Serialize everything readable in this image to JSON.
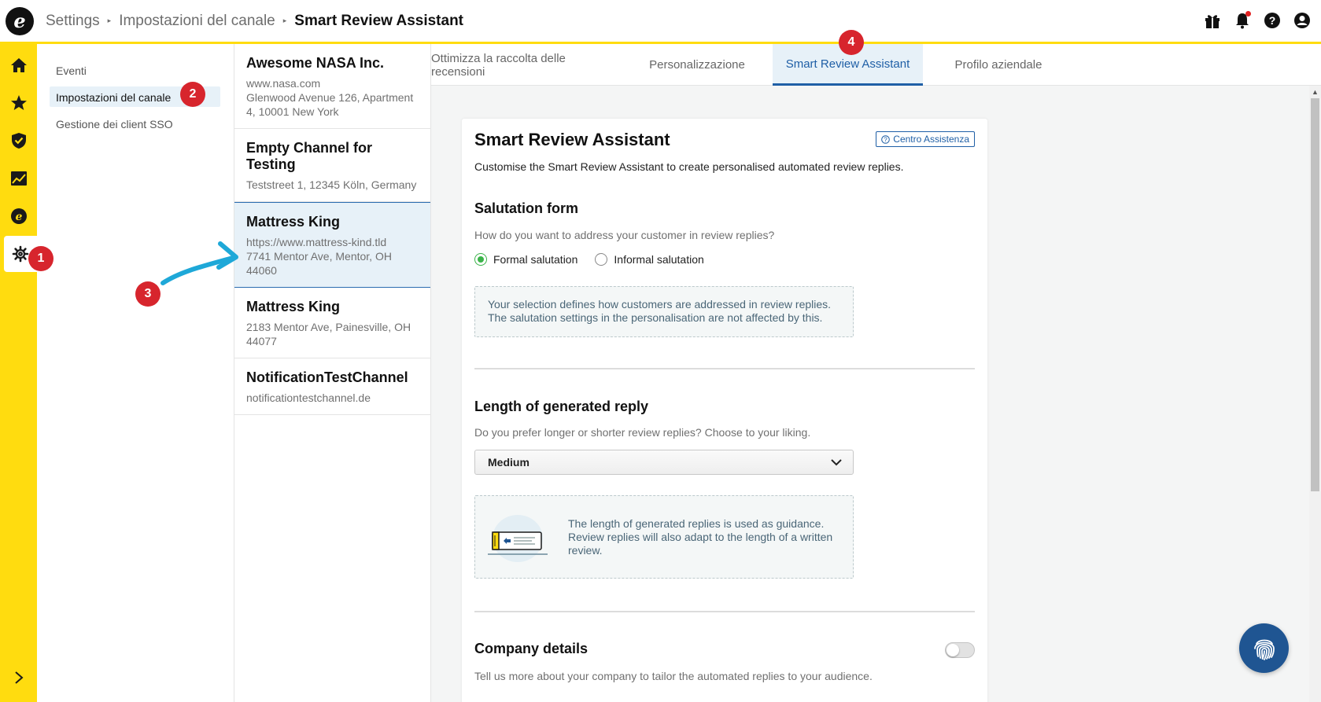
{
  "header": {
    "logo_letter": "e",
    "breadcrumbs": [
      "Settings",
      "Impostazioni del canale"
    ],
    "current": "Smart Review Assistant",
    "icons": [
      "gift-icon",
      "bell-icon",
      "help-icon",
      "user-icon"
    ]
  },
  "rail": {
    "items": [
      "home-icon",
      "star-icon",
      "shield-check-icon",
      "chart-icon",
      "trusted-logo-icon",
      "gear-icon"
    ],
    "active": "gear-icon",
    "expand": "chevron-right-icon"
  },
  "subnav": {
    "items": [
      {
        "label": "Eventi"
      },
      {
        "label": "Impostazioni del canale",
        "active": true
      },
      {
        "label": "Gestione dei client SSO"
      }
    ]
  },
  "channels": [
    {
      "name": "Awesome NASA Inc.",
      "lines": [
        "www.nasa.com",
        "Glenwood Avenue 126, Apartment",
        "4, 10001 New York"
      ]
    },
    {
      "name": "Empty Channel for Testing",
      "lines": [
        "Teststreet 1, 12345 Köln, Germany"
      ]
    },
    {
      "name": "Mattress King",
      "lines": [
        "https://www.mattress-kind.tld",
        "7741 Mentor Ave, Mentor, OH",
        "44060"
      ],
      "active": true
    },
    {
      "name": "Mattress King",
      "lines": [
        "2183 Mentor Ave, Painesville, OH",
        "44077"
      ]
    },
    {
      "name": "NotificationTestChannel",
      "lines": [
        "notificationtestchannel.de"
      ]
    }
  ],
  "tabs": [
    {
      "label": "Ottimizza la raccolta delle recensioni"
    },
    {
      "label": "Personalizzazione"
    },
    {
      "label": "Smart Review Assistant",
      "active": true
    },
    {
      "label": "Profilo aziendale"
    }
  ],
  "card": {
    "title": "Smart Review Assistant",
    "help_label": "Centro Assistenza",
    "description": "Customise the Smart Review Assistant to create personalised automated review replies.",
    "salutation": {
      "title": "Salutation form",
      "question": "How do you want to address your customer in review replies?",
      "options": [
        "Formal salutation",
        "Informal salutation"
      ],
      "selected": "Formal salutation",
      "info_lines": [
        "Your selection defines how customers are addressed in review replies.",
        "The salutation settings in the personalisation are not affected by this."
      ]
    },
    "length": {
      "title": "Length of generated reply",
      "question": "Do you prefer longer or shorter review replies? Choose to your liking.",
      "selected": "Medium",
      "info_lines": [
        "The length of generated replies is used as guidance.",
        "Review replies will also adapt to the length of a written",
        "review."
      ]
    },
    "company": {
      "title": "Company details",
      "question": "Tell us more about your company to tailor the automated replies to your audience.",
      "enabled": false
    }
  },
  "annotations": [
    "1",
    "2",
    "3",
    "4"
  ],
  "colors": {
    "brand_yellow": "#ffdc0f",
    "accent_blue": "#1f5fa6",
    "selected_bg": "#e7f1f8",
    "annotation_red": "#d7252d",
    "arrow_cyan": "#1ea8d8",
    "radio_green": "#3bb34a"
  }
}
